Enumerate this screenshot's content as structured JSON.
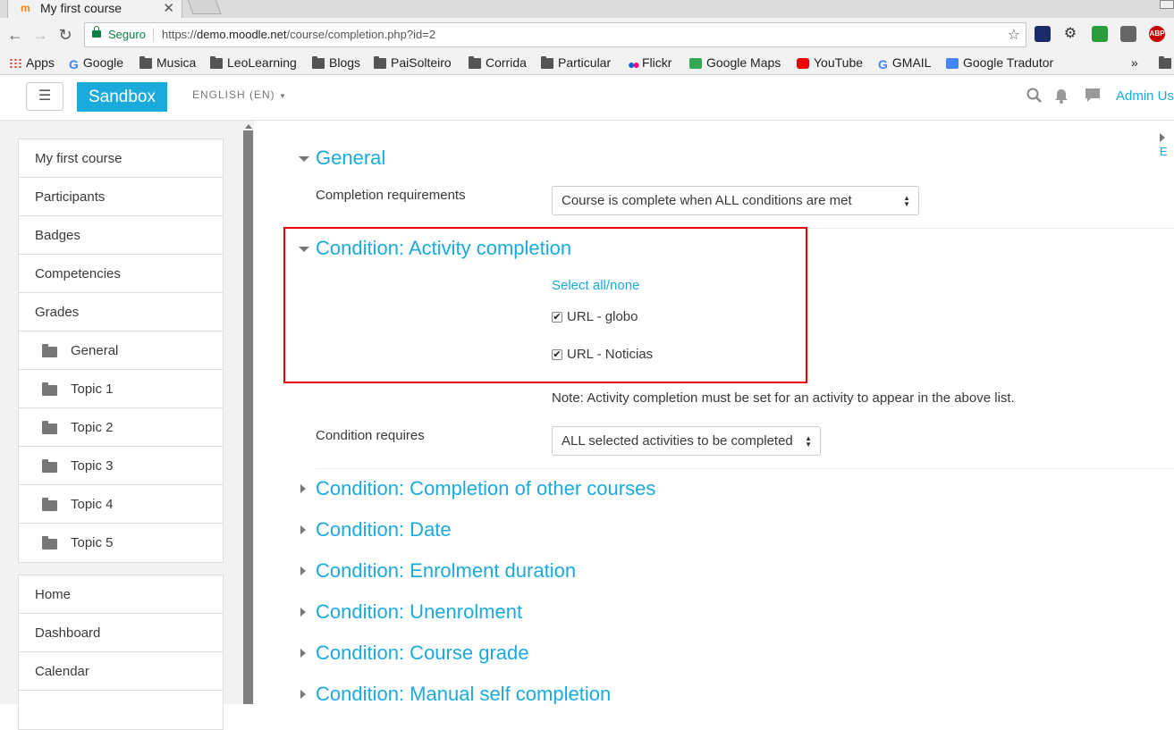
{
  "browser": {
    "tab_title": "My first course",
    "tab_close": "✕",
    "secure_label": "Seguro",
    "url_scheme": "https://",
    "url_host": "demo.moodle.net",
    "url_path": "/course/completion.php?id=2",
    "star": "☆",
    "bookmarks": [
      "Apps",
      "Google",
      "Musica",
      "LeoLearning",
      "Blogs",
      "PaiSolteiro",
      "Corrida",
      "Particular",
      "Flickr",
      "Google Maps",
      "YouTube",
      "GMAIL",
      "Google Tradutor"
    ],
    "bookmarks_more": "»",
    "ext_abp": "ABP"
  },
  "navbar": {
    "menu_icon": "☰",
    "brand": "Sandbox",
    "language": "ENGLISH (EN)",
    "user": "Admin Us"
  },
  "drawer": {
    "course_items": [
      {
        "label": "My first course",
        "sub": false
      },
      {
        "label": "Participants",
        "sub": false
      },
      {
        "label": "Badges",
        "sub": false
      },
      {
        "label": "Competencies",
        "sub": false
      },
      {
        "label": "Grades",
        "sub": false
      },
      {
        "label": "General",
        "sub": true
      },
      {
        "label": "Topic 1",
        "sub": true
      },
      {
        "label": "Topic 2",
        "sub": true
      },
      {
        "label": "Topic 3",
        "sub": true
      },
      {
        "label": "Topic 4",
        "sub": true
      },
      {
        "label": "Topic 5",
        "sub": true
      }
    ],
    "site_items": [
      "Home",
      "Dashboard",
      "Calendar"
    ]
  },
  "main": {
    "expand_all_cut": "E",
    "general": {
      "heading": "General",
      "completion_requirements_label": "Completion requirements",
      "completion_requirements_value": "Course is complete when ALL conditions are met"
    },
    "activity_completion": {
      "heading": "Condition: Activity completion",
      "select_all": "Select all/none",
      "activities": [
        {
          "label": "URL - globo",
          "checked": true
        },
        {
          "label": "URL - Noticias",
          "checked": true
        }
      ],
      "note": "Note: Activity completion must be set for an activity to appear in the above list.",
      "condition_requires_label": "Condition requires",
      "condition_requires_value": "ALL selected activities to be completed"
    },
    "collapsed_sections": [
      "Condition: Completion of other courses",
      "Condition: Date",
      "Condition: Enrolment duration",
      "Condition: Unenrolment",
      "Condition: Course grade",
      "Condition: Manual self completion"
    ]
  }
}
